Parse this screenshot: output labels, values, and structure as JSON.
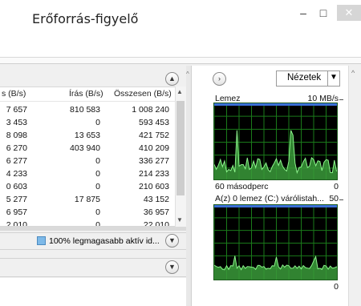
{
  "window": {
    "title": "Erőforrás-figyelő",
    "minimize_glyph": "–",
    "maximize_glyph": "□",
    "close_glyph": "✕"
  },
  "disk_table": {
    "columns": [
      "s (B/s)",
      "Írás (B/s)",
      "Összesen (B/s)"
    ],
    "rows": [
      [
        "7 657",
        "810 583",
        "1 008 240"
      ],
      [
        "3 453",
        "0",
        "593 453"
      ],
      [
        "8 098",
        "13 653",
        "421 752"
      ],
      [
        "6 270",
        "403 940",
        "410 209"
      ],
      [
        "6 277",
        "0",
        "336 277"
      ],
      [
        "4 233",
        "0",
        "214 233"
      ],
      [
        "0 603",
        "0",
        "210 603"
      ],
      [
        "5 277",
        "17 875",
        "43 152"
      ],
      [
        "6 957",
        "0",
        "36 957"
      ],
      [
        "2 010",
        "0",
        "22 010"
      ]
    ]
  },
  "storage_bar": {
    "label": "100% legmagasabb aktív id..."
  },
  "right": {
    "views_label": "Nézetek",
    "graph1": {
      "title": "Lemez",
      "max_label": "10 MB/s",
      "duration": "60 másodperc",
      "min_label": "0"
    },
    "graph2": {
      "title": "A(z) 0 lemez (C:) várólistah...",
      "max_label": "50",
      "min_label": "0"
    }
  },
  "colors": {
    "graph_bg": "#000000",
    "grid": "#1a7a1a",
    "fill": "#3a9a3a",
    "line": "#8cf58c",
    "blue_marker": "#3b6fd8"
  }
}
